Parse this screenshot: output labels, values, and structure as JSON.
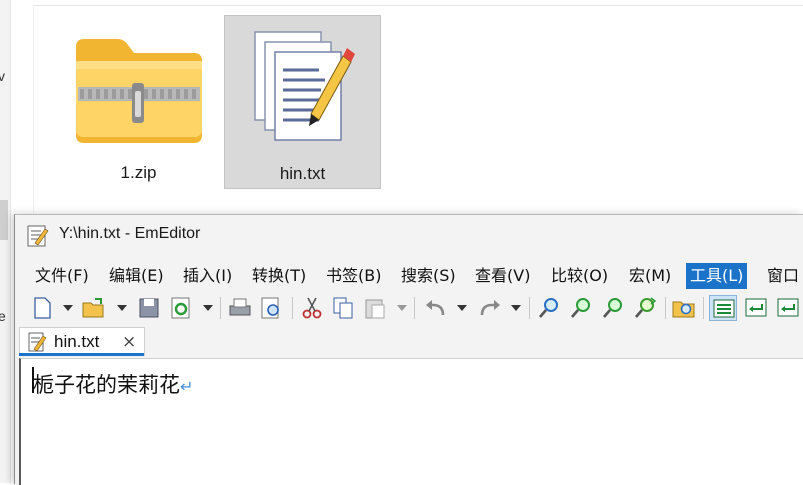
{
  "explorer": {
    "files": [
      {
        "name": "1.zip",
        "icon": "zip-folder-icon",
        "selected": false
      },
      {
        "name": "hin.txt",
        "icon": "text-document-icon",
        "selected": true
      }
    ],
    "strip_chars": [
      "v",
      "e"
    ]
  },
  "editor_window": {
    "title": "Y:\\hin.txt - EmEditor",
    "menus": [
      "文件(F)",
      "编辑(E)",
      "插入(I)",
      "转换(T)",
      "书签(B)",
      "搜索(S)",
      "查看(V)",
      "比较(O)",
      "宏(M)",
      "工具(L)",
      "窗口"
    ],
    "active_menu": "工具(L)",
    "toolbar_icons": [
      "new-file-icon",
      "open-folder-icon",
      "save-icon",
      "reload-icon",
      "print-icon",
      "print-preview-icon",
      "cut-icon",
      "copy-icon",
      "paste-icon",
      "undo-icon",
      "redo-icon",
      "find-icon",
      "find-next-icon",
      "find-previous-icon",
      "replace-icon",
      "find-in-files-icon",
      "wrap-toggle-icon",
      "wrap-window-icon",
      "wrap-page-icon"
    ],
    "tab": {
      "label": "hin.txt",
      "close": "×"
    },
    "content": "栀子花的茉莉花",
    "eol_mark": "↵"
  },
  "colors": {
    "accent": "#1a73c9",
    "selection_bg": "#d9d9d9"
  }
}
